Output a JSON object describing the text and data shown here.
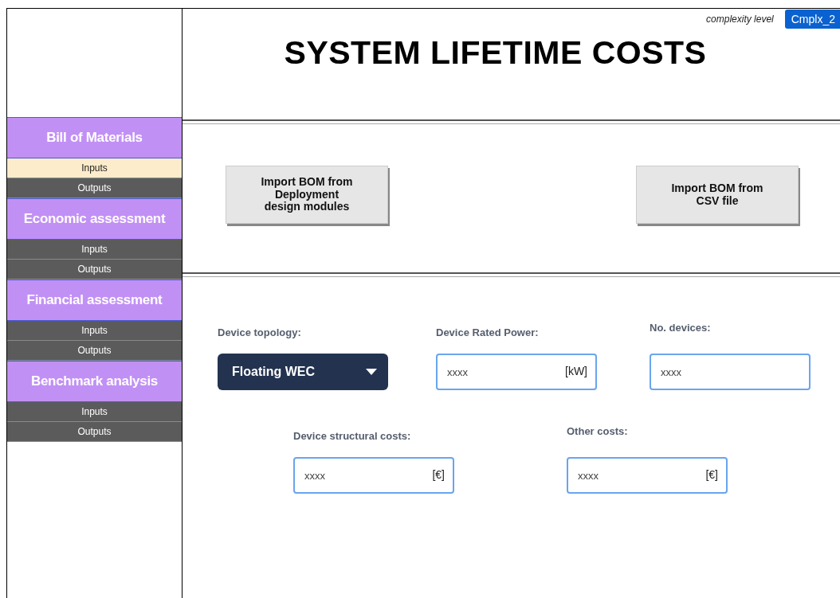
{
  "header": {
    "complexity_label": "complexity level",
    "complexity_value": "Cmplx_2",
    "title": "SYSTEM LIFETIME COSTS"
  },
  "sidebar": {
    "sections": [
      {
        "title": "Bill of Materials",
        "items": [
          {
            "label": "Inputs",
            "selected": true
          },
          {
            "label": "Outputs",
            "selected": false
          }
        ]
      },
      {
        "title": "Economic assessment",
        "items": [
          {
            "label": "Inputs",
            "selected": false
          },
          {
            "label": "Outputs",
            "selected": false
          }
        ]
      },
      {
        "title": "Financial assessment",
        "items": [
          {
            "label": "Inputs",
            "selected": false
          },
          {
            "label": "Outputs",
            "selected": false
          }
        ]
      },
      {
        "title": "Benchmark analysis",
        "items": [
          {
            "label": "Inputs",
            "selected": false
          },
          {
            "label": "Outputs",
            "selected": false
          }
        ]
      }
    ]
  },
  "import_buttons": [
    "Import BOM from Deployment design modules",
    "Import BOM from CSV file"
  ],
  "form": {
    "topology": {
      "label": "Device topology:",
      "value": "Floating WEC"
    },
    "fields": [
      {
        "label": "Device Rated Power:",
        "placeholder": "xxxx",
        "unit": "[kW]"
      },
      {
        "label": "No. devices:",
        "placeholder": "xxxx"
      },
      {
        "label": "Device structural costs:",
        "placeholder": "xxxx",
        "unit": "[€]"
      },
      {
        "label": "Other costs:",
        "placeholder": "xxxx",
        "unit": "[€]"
      }
    ]
  }
}
